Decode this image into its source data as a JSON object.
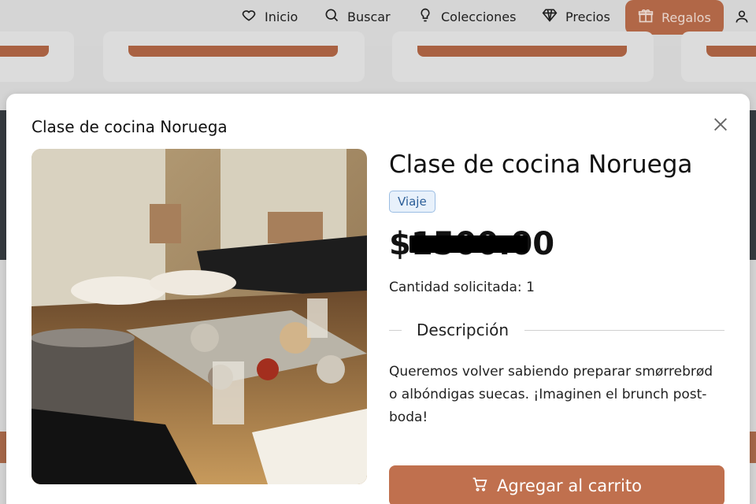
{
  "nav": {
    "items": [
      {
        "label": "Inicio",
        "icon": "heart-icon"
      },
      {
        "label": "Buscar",
        "icon": "search-icon"
      },
      {
        "label": "Colecciones",
        "icon": "lightbulb-icon"
      },
      {
        "label": "Precios",
        "icon": "diamond-icon"
      },
      {
        "label": "Regalos",
        "icon": "gift-icon"
      }
    ],
    "user_icon": "user-icon",
    "accent": "#c0704e"
  },
  "modal": {
    "header_title": "Clase de cocina Noruega",
    "product_title": "Clase de cocina Noruega",
    "tag": "Viaje",
    "price_symbol": "$",
    "price_value": "1500.00",
    "quantity_label": "Cantidad solicitada:",
    "quantity_value": "1",
    "description_label": "Descripción",
    "description": "Queremos volver sabiendo preparar smørrebrød o albóndigas suecas. ¡Imaginen el brunch post-boda!",
    "add_to_cart": "Agregar al carrito",
    "close_icon": "close-icon",
    "cart_icon": "cart-icon"
  },
  "colors": {
    "accent": "#c0704e",
    "tag_border": "#9bbde3",
    "tag_text": "#2b5e98"
  }
}
